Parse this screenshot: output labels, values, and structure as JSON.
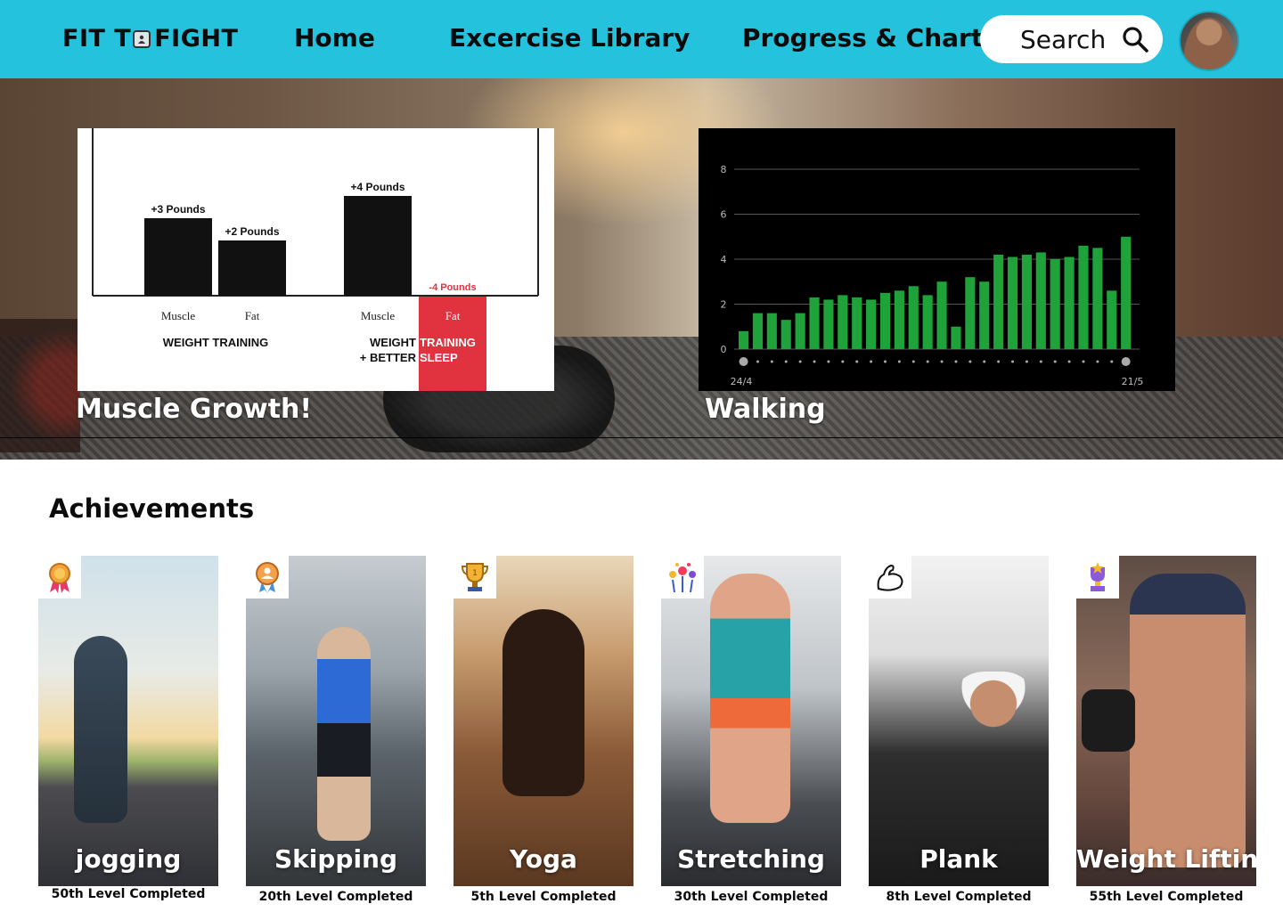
{
  "header": {
    "brand_left": "FIT T",
    "brand_right": "FIGHT",
    "brand_icon": "person-icon",
    "nav": {
      "home": "Home",
      "library": "Excercise Library",
      "progress": "Progress & Chart"
    },
    "search_text": "Search"
  },
  "hero": {
    "muscle_caption": "Muscle Growth!",
    "walk_caption": "Walking"
  },
  "muscle_chart": {
    "chart_data": {
      "type": "bar",
      "groups": [
        {
          "name": "WEIGHT TRAINING",
          "bars": [
            {
              "label": "Muscle",
              "value": 3,
              "text": "+3 Pounds"
            },
            {
              "label": "Fat",
              "value": 2,
              "text": "+2 Pounds"
            }
          ]
        },
        {
          "name": "WEIGHT TRAINING + BETTER SLEEP",
          "bars": [
            {
              "label": "Muscle",
              "value": 4,
              "text": "+4 Pounds"
            },
            {
              "label": "Fat",
              "value": -4,
              "text": "-4 Pounds"
            }
          ]
        }
      ],
      "group_label_lines": [
        [
          "WEIGHT TRAINING"
        ],
        [
          "WEIGHT",
          "TRAINING",
          "+ BETTER",
          "SLEEP"
        ]
      ],
      "highlight_color": "#e1323f",
      "bar_color": "#111111"
    }
  },
  "walk_chart": {
    "chart_data": {
      "type": "bar",
      "x_start_label": "24/4",
      "x_end_label": "21/5",
      "yticks": [
        "0",
        "2",
        "4",
        "6",
        "8"
      ],
      "ylim": [
        0,
        8
      ],
      "values": [
        0.8,
        1.6,
        1.6,
        1.3,
        1.6,
        2.3,
        2.2,
        2.4,
        2.3,
        2.2,
        2.5,
        2.6,
        2.8,
        2.4,
        3.0,
        1.0,
        3.2,
        3.0,
        4.2,
        4.1,
        4.2,
        4.3,
        4.0,
        4.1,
        4.6,
        4.5,
        2.6,
        5.0
      ],
      "bar_color": "#1fa23a",
      "background": "#000000"
    }
  },
  "achievements": {
    "title": "Achievements",
    "items": [
      {
        "name": "jogging",
        "level": "50th Level Completed",
        "badge": "ribbon-medal-icon"
      },
      {
        "name": "Skipping",
        "level": "20th Level Completed",
        "badge": "award-badge-icon"
      },
      {
        "name": "Yoga",
        "level": "5th Level Completed",
        "badge": "trophy-icon"
      },
      {
        "name": "Stretching",
        "level": "30th Level Completed",
        "badge": "fireworks-icon"
      },
      {
        "name": "Plank",
        "level": "8th Level Completed",
        "badge": "flexed-arm-icon"
      },
      {
        "name": "Weight Lifting",
        "level": "55th Level Completed",
        "badge": "star-trophy-icon"
      }
    ]
  }
}
